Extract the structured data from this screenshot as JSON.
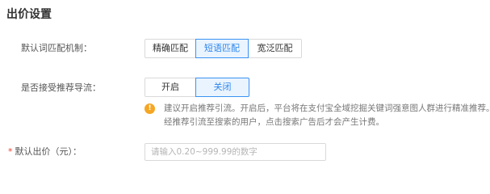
{
  "section": {
    "title": "出价设置"
  },
  "match_mode": {
    "label": "默认词匹配机制：",
    "options": [
      "精确匹配",
      "短语匹配",
      "宽泛匹配"
    ],
    "selected": "短语匹配"
  },
  "traffic": {
    "label": "是否接受推荐导流：",
    "options": [
      "开启",
      "关闭"
    ],
    "selected": "关闭",
    "tip_icon": "!",
    "tip_line1": "建议开启推荐引流。开启后，平台将在支付宝全域挖掘关键词强意图人群进行精准推荐。",
    "tip_line2": "经推荐引流至搜索的用户，点击搜索广告后才会产生计费。"
  },
  "default_bid": {
    "required_mark": "*",
    "label": "默认出价（元）：",
    "value": "",
    "placeholder": "请输入0.20~999.99的数字"
  },
  "colors": {
    "accent": "#2c86ec",
    "active_bg": "#eaf4ff",
    "warning": "#f5a623",
    "required": "#f04134"
  }
}
